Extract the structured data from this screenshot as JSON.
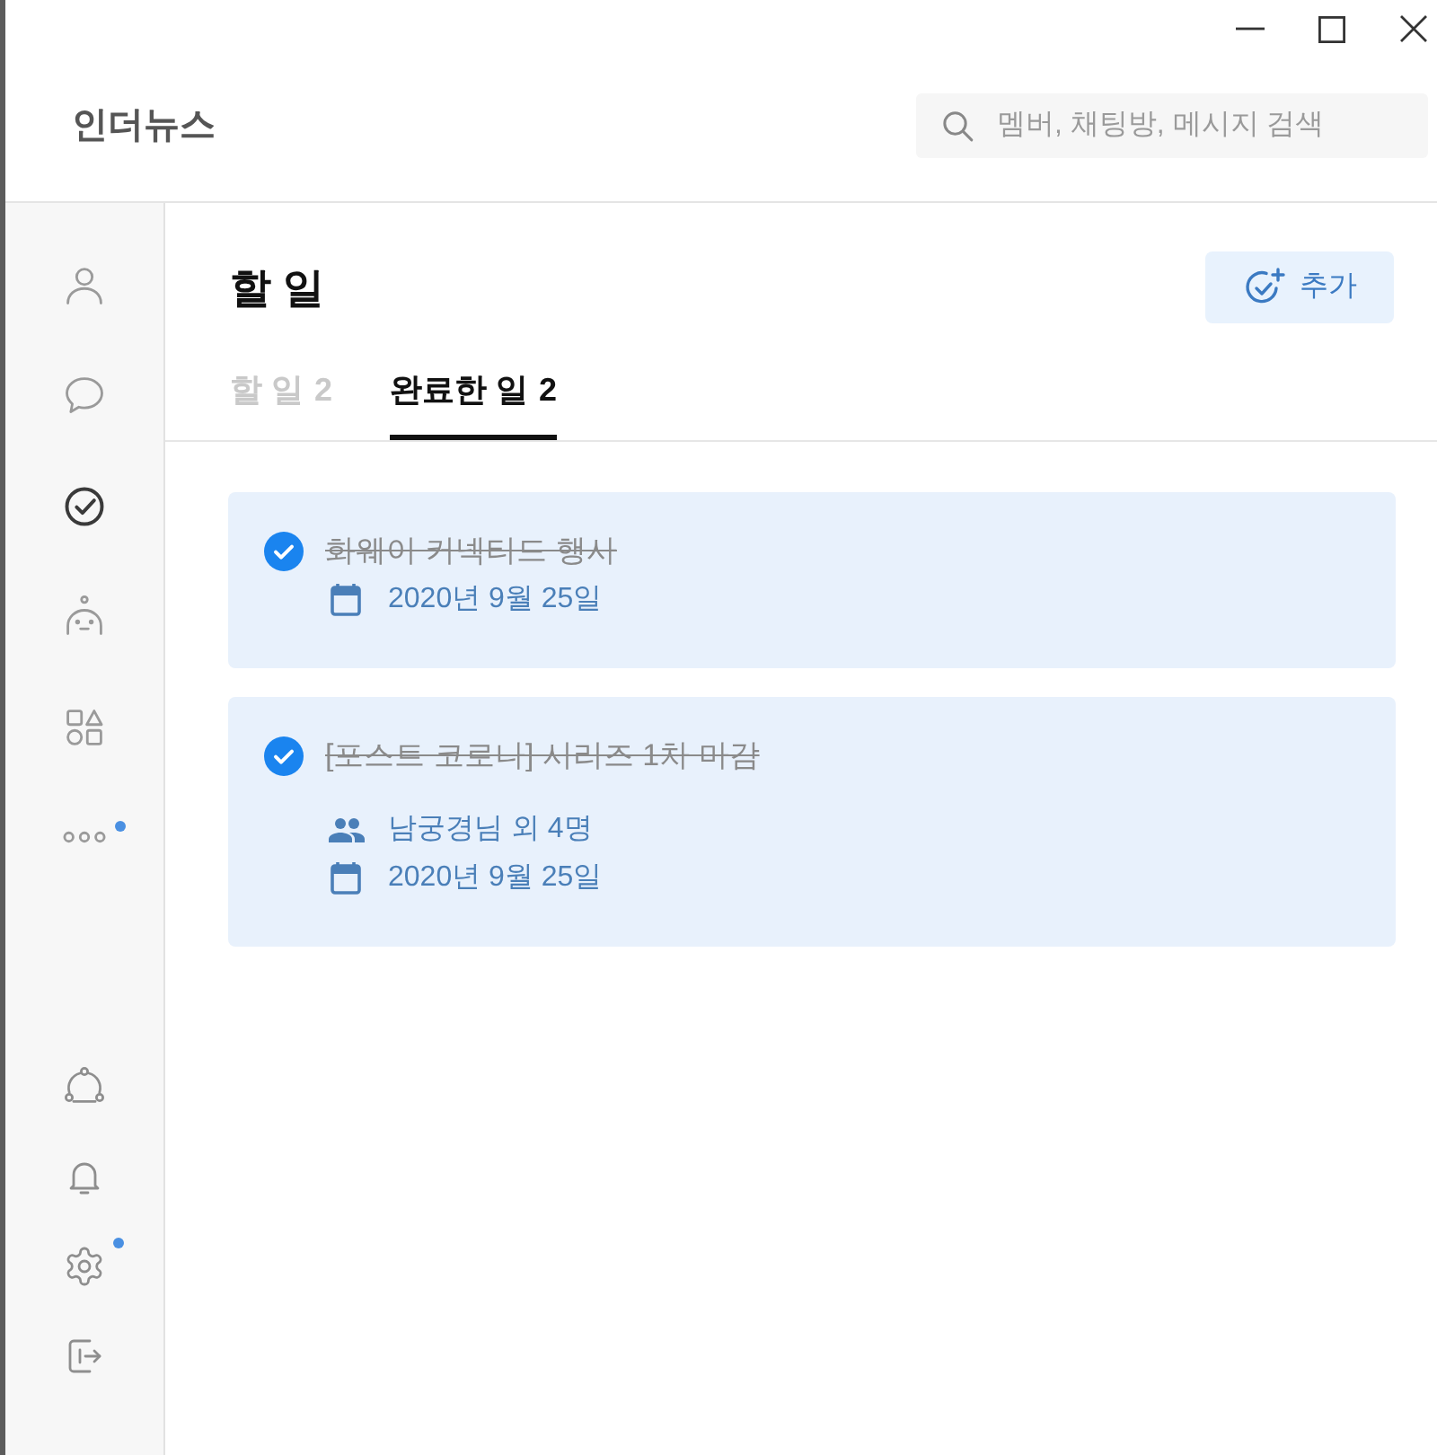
{
  "window": {
    "app_name": "인더뉴스"
  },
  "search": {
    "placeholder": "멤버, 채팅방, 메시지 검색"
  },
  "sidebar": {
    "items": [
      {
        "selected": false,
        "badge": false
      },
      {
        "selected": false,
        "badge": false
      },
      {
        "selected": true,
        "badge": false
      },
      {
        "selected": false,
        "badge": false
      },
      {
        "selected": false,
        "badge": false
      },
      {
        "selected": false,
        "badge": true
      }
    ],
    "bottom_items": [
      {
        "badge": false
      },
      {
        "badge": false
      },
      {
        "badge": true
      },
      {
        "badge": false
      }
    ]
  },
  "page": {
    "title": "할 일",
    "add_button": "추가"
  },
  "tabs": [
    {
      "label": "할 일",
      "count": "2",
      "selected": false
    },
    {
      "label": "완료한 일",
      "count": "2",
      "selected": true
    }
  ],
  "tasks": [
    {
      "title": "화웨이 커넥티드 행사",
      "done": true,
      "date": "2020년 9월 25일"
    },
    {
      "title": "[포스트 코로나] 시리즈 1차 마감",
      "done": true,
      "assignees": "남궁경님 외 4명",
      "date": "2020년 9월 25일"
    }
  ]
}
